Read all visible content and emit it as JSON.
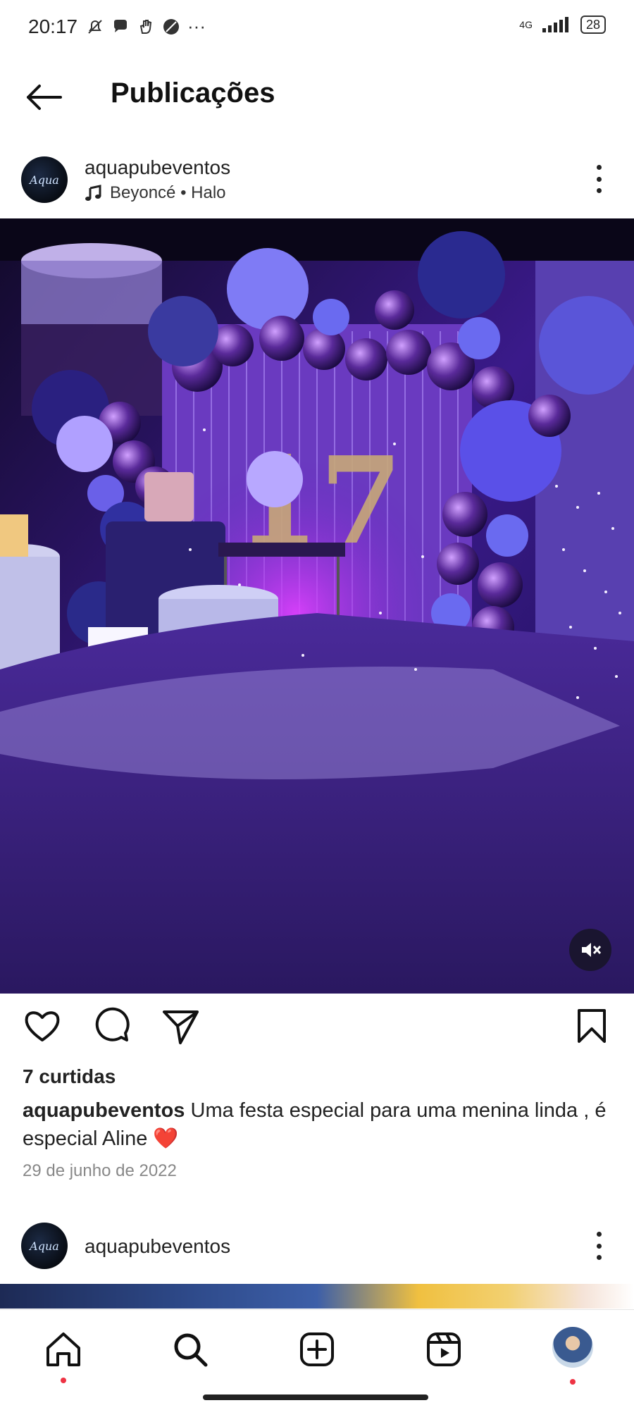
{
  "status_bar": {
    "time": "20:17",
    "network": "4G",
    "battery": "28",
    "more": "···"
  },
  "header": {
    "title": "Publicações"
  },
  "post": {
    "username": "aquapubeventos",
    "avatar_text": "Aqua",
    "music": "Beyoncé • Halo",
    "likes": "7 curtidas",
    "caption_user": "aquapubeventos",
    "caption_text": " Uma festa especial para uma menina linda , é especial  Aline ❤️",
    "date": "29 de junho de 2022",
    "number_decoration": "17"
  },
  "next_post": {
    "username": "aquapubeventos",
    "avatar_text": "Aqua"
  },
  "colors": {
    "accent": "#ee3344",
    "text": "#222222",
    "muted": "#888888"
  },
  "icons": {
    "back": "arrow-left-icon",
    "like": "heart-icon",
    "comment": "comment-icon",
    "share": "send-icon",
    "save": "bookmark-icon",
    "mute": "muted-speaker-icon",
    "nav": [
      "home-icon",
      "search-icon",
      "create-icon",
      "reels-icon",
      "profile-avatar"
    ]
  }
}
